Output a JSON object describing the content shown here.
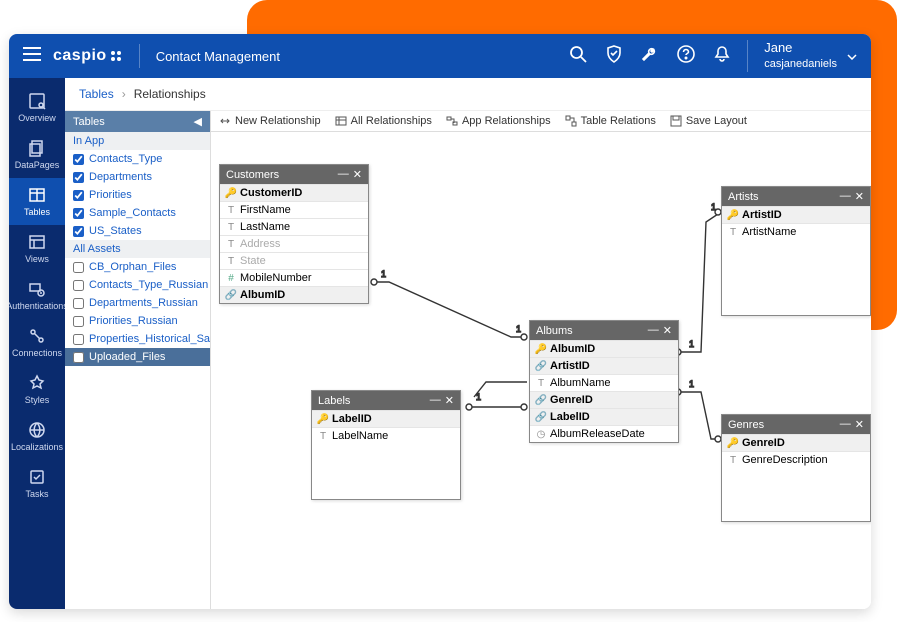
{
  "header": {
    "logo": "caspio",
    "app_title": "Contact Management",
    "user_name": "Jane",
    "user_handle": "casjanedaniels"
  },
  "sidebar": {
    "items": [
      {
        "label": "Overview"
      },
      {
        "label": "DataPages"
      },
      {
        "label": "Tables"
      },
      {
        "label": "Views"
      },
      {
        "label": "Authentications"
      },
      {
        "label": "Connections"
      },
      {
        "label": "Styles"
      },
      {
        "label": "Localizations"
      },
      {
        "label": "Tasks"
      }
    ]
  },
  "breadcrumb": {
    "root": "Tables",
    "current": "Relationships"
  },
  "left_panel": {
    "title": "Tables",
    "section1": "In App",
    "in_app": [
      {
        "name": "Contacts_Type",
        "checked": true
      },
      {
        "name": "Departments",
        "checked": true
      },
      {
        "name": "Priorities",
        "checked": true
      },
      {
        "name": "Sample_Contacts",
        "checked": true
      },
      {
        "name": "US_States",
        "checked": true
      }
    ],
    "section2": "All Assets",
    "all_assets": [
      {
        "name": "CB_Orphan_Files",
        "checked": false
      },
      {
        "name": "Contacts_Type_Russian",
        "checked": false
      },
      {
        "name": "Departments_Russian",
        "checked": false
      },
      {
        "name": "Priorities_Russian",
        "checked": false
      },
      {
        "name": "Properties_Historical_Sales",
        "checked": false
      },
      {
        "name": "Uploaded_Files",
        "checked": false,
        "selected": true
      }
    ]
  },
  "toolbar": {
    "new_rel": "New Relationship",
    "all_rel": "All Relationships",
    "app_rel": "App Relationships",
    "table_rel": "Table Relations",
    "save": "Save Layout"
  },
  "entities": {
    "customers": {
      "title": "Customers",
      "fields": [
        {
          "name": "CustomerID",
          "key": true,
          "icon": "key"
        },
        {
          "name": "FirstName",
          "icon": "txt"
        },
        {
          "name": "LastName",
          "icon": "txt"
        },
        {
          "name": "Address",
          "icon": "txt",
          "disabled": true
        },
        {
          "name": "State",
          "icon": "txt",
          "disabled": true
        },
        {
          "name": "MobileNumber",
          "icon": "num"
        },
        {
          "name": "AlbumID",
          "key": true,
          "icon": "link"
        }
      ]
    },
    "albums": {
      "title": "Albums",
      "fields": [
        {
          "name": "AlbumID",
          "key": true,
          "icon": "key"
        },
        {
          "name": "ArtistID",
          "key": true,
          "icon": "link"
        },
        {
          "name": "AlbumName",
          "icon": "txt"
        },
        {
          "name": "GenreID",
          "key": true,
          "icon": "link"
        },
        {
          "name": "LabelID",
          "key": true,
          "icon": "link"
        },
        {
          "name": "AlbumReleaseDate",
          "icon": "date"
        }
      ]
    },
    "artists": {
      "title": "Artists",
      "fields": [
        {
          "name": "ArtistID",
          "key": true,
          "icon": "key"
        },
        {
          "name": "ArtistName",
          "icon": "txt"
        }
      ]
    },
    "labels": {
      "title": "Labels",
      "fields": [
        {
          "name": "LabelID",
          "key": true,
          "icon": "key"
        },
        {
          "name": "LabelName",
          "icon": "txt"
        }
      ]
    },
    "genres": {
      "title": "Genres",
      "fields": [
        {
          "name": "GenreID",
          "key": true,
          "icon": "key"
        },
        {
          "name": "GenreDescription",
          "icon": "txt"
        }
      ]
    }
  }
}
